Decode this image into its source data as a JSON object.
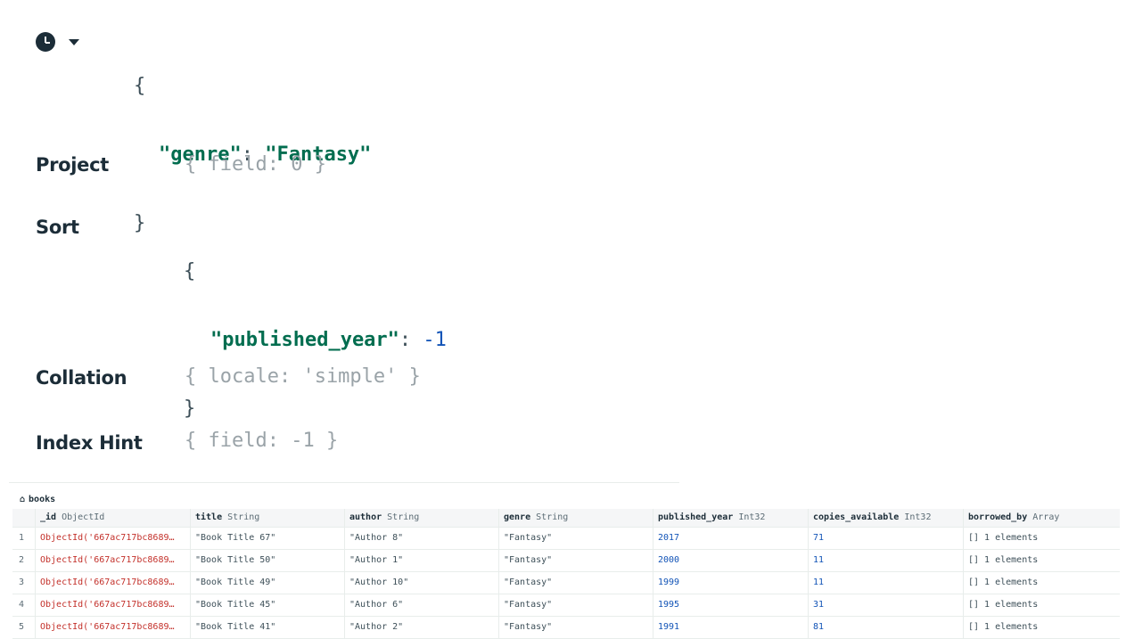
{
  "query": {
    "filter": {
      "open_brace": "{",
      "key": "\"genre\"",
      "colon": ": ",
      "value": "\"Fantasy\"",
      "close_brace": "}"
    },
    "project": {
      "label": "Project",
      "placeholder": "{ field: 0 }"
    },
    "sort": {
      "label": "Sort",
      "open_brace": "{",
      "key": "\"published_year\"",
      "colon": ": ",
      "value": "-1",
      "close_brace": "}"
    },
    "collation": {
      "label": "Collation",
      "placeholder": "{ locale: 'simple' }"
    },
    "index_hint": {
      "label": "Index Hint",
      "placeholder": "{ field: -1 }"
    }
  },
  "results": {
    "tab_label": "books",
    "columns": [
      {
        "name": "_id",
        "type": "ObjectId"
      },
      {
        "name": "title",
        "type": "String"
      },
      {
        "name": "author",
        "type": "String"
      },
      {
        "name": "genre",
        "type": "String"
      },
      {
        "name": "published_year",
        "type": "Int32"
      },
      {
        "name": "copies_available",
        "type": "Int32"
      },
      {
        "name": "borrowed_by",
        "type": "Array"
      }
    ],
    "rows": [
      {
        "n": "1",
        "id": "ObjectId('667ac717bc8689…",
        "title": "\"Book Title 67\"",
        "author": "\"Author 8\"",
        "genre": "\"Fantasy\"",
        "year": "2017",
        "copies": "71",
        "borrowed": "[] 1 elements"
      },
      {
        "n": "2",
        "id": "ObjectId('667ac717bc8689…",
        "title": "\"Book Title 50\"",
        "author": "\"Author 1\"",
        "genre": "\"Fantasy\"",
        "year": "2000",
        "copies": "11",
        "borrowed": "[] 1 elements"
      },
      {
        "n": "3",
        "id": "ObjectId('667ac717bc8689…",
        "title": "\"Book Title 49\"",
        "author": "\"Author 10\"",
        "genre": "\"Fantasy\"",
        "year": "1999",
        "copies": "11",
        "borrowed": "[] 1 elements"
      },
      {
        "n": "4",
        "id": "ObjectId('667ac717bc8689…",
        "title": "\"Book Title 45\"",
        "author": "\"Author 6\"",
        "genre": "\"Fantasy\"",
        "year": "1995",
        "copies": "31",
        "borrowed": "[] 1 elements"
      },
      {
        "n": "5",
        "id": "ObjectId('667ac717bc8689…",
        "title": "\"Book Title 41\"",
        "author": "\"Author 2\"",
        "genre": "\"Fantasy\"",
        "year": "1991",
        "copies": "81",
        "borrowed": "[] 1 elements"
      }
    ]
  }
}
